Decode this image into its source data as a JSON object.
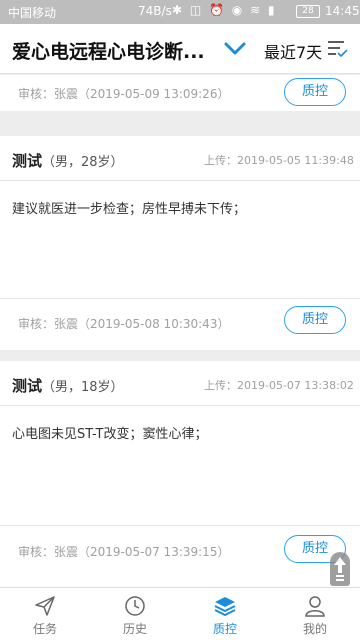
{
  "status_bar": {
    "carrier": "中国移动",
    "speed": "74B/s",
    "battery": "28",
    "time": "14:45"
  },
  "header": {
    "title": "爱心电远程心电诊断...",
    "date_range": "最近7天",
    "range_icon": "chevron-down-icon",
    "menu_icon": "menu-check-icon"
  },
  "records": [
    {
      "review": "审核：张震（2019-05-09 13:09:26）",
      "qc_label": "质控"
    },
    {
      "name": "测试",
      "info": "（男，28岁）",
      "upload": "上传：2019-05-05 11:39:48",
      "diagnosis": "建议就医进一步检查；房性早搏未下传；",
      "review": "审核：张震（2019-05-08 10:30:43）",
      "qc_label": "质控"
    },
    {
      "name": "测试",
      "info": "（男，18岁）",
      "upload": "上传：2019-05-07 13:38:02",
      "diagnosis": "心电图未见ST-T改变；窦性心律；",
      "review": "审核：张震（2019-05-07 13:39:15）",
      "qc_label": "质控"
    }
  ],
  "tabs": [
    {
      "label": "任务",
      "icon": "send-icon",
      "active": false
    },
    {
      "label": "历史",
      "icon": "clock-icon",
      "active": false
    },
    {
      "label": "质控",
      "icon": "layers-icon",
      "active": true
    },
    {
      "label": "我的",
      "icon": "user-icon",
      "active": false
    }
  ],
  "colors": {
    "accent": "#1a8fd8",
    "status_bar": "#bdbdbd",
    "background": "#ededed"
  }
}
